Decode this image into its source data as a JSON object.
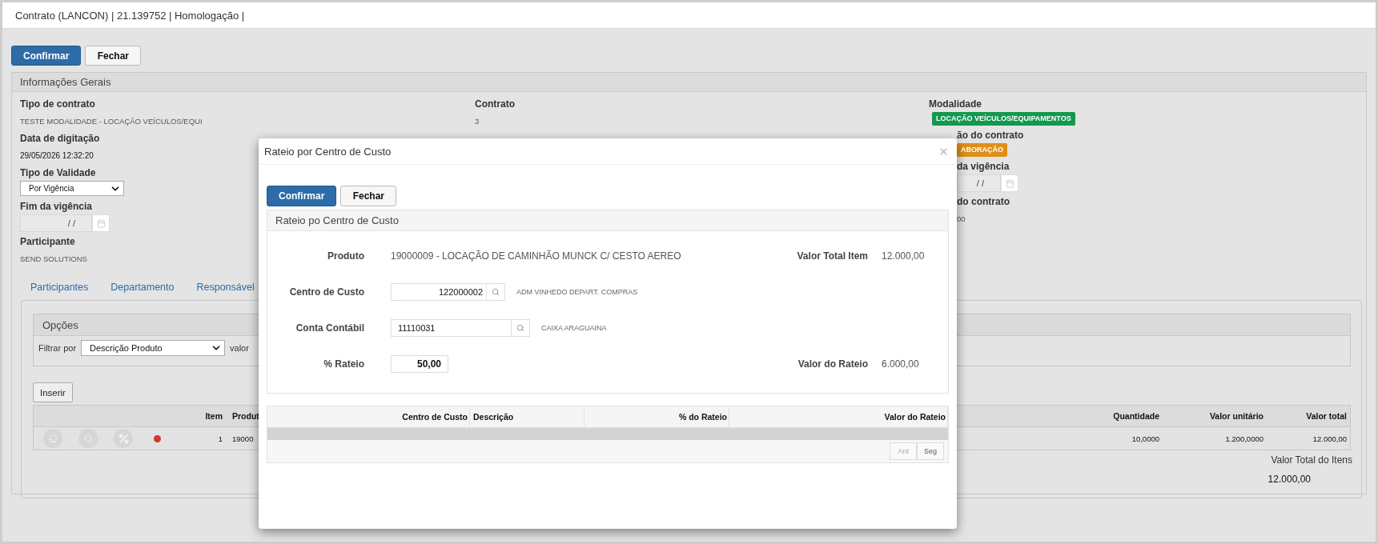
{
  "window": {
    "title": "Contrato (LANCON) | 21.139752 | Homologação |"
  },
  "toolbar": {
    "buttons": [
      {
        "label": "Confirmar",
        "kind": "primary"
      },
      {
        "label": "Fechar",
        "kind": "default"
      }
    ]
  },
  "general_info": {
    "title": "Informações Gerais",
    "column_1": [
      {
        "label": "Tipo de contrato",
        "value": "TESTE MODALIDADE - LOCAÇÃO VEÍCULOS/EQUI",
        "kind": "text"
      },
      {
        "label": "Data de digitação",
        "value": "29/05/2026 12:32:20",
        "kind": "strong"
      },
      {
        "label": "Tipo de Validade",
        "value": "Por Vigência",
        "kind": "select"
      },
      {
        "label": "Fim da vigência",
        "value": "/ /",
        "kind": "date"
      },
      {
        "label": "Participante",
        "value": "SEND SOLUTIONS",
        "kind": "text"
      }
    ],
    "column_2": [
      {
        "label": "Contrato",
        "value": "3",
        "kind": "text"
      }
    ],
    "column_3": [
      {
        "label": "Modalidade",
        "value": "LOCAÇÃO VEÍCULOS/EQUIPAMENTOS",
        "kind": "badge",
        "color": "#13994f",
        "cut": false
      },
      {
        "label": "ão do contrato",
        "value": "ABORAÇÃO",
        "kind": "badge",
        "color": "#e08e16",
        "cut": true
      },
      {
        "label": "da vigência",
        "value": "/ /",
        "kind": "date",
        "cut": true
      },
      {
        "label": "do contrato",
        "value": "00",
        "kind": "text",
        "cut": true
      }
    ]
  },
  "tabs": [
    {
      "label": "Participantes",
      "selected": false
    },
    {
      "label": "Departamento",
      "selected": false
    },
    {
      "label": "Responsável",
      "selected": false
    }
  ],
  "options": {
    "title": "Opções",
    "filter_label": "Filtrar por",
    "filter_value": "Descrição Produto",
    "value_label": "valor"
  },
  "insert_button": "Inserir",
  "items_table": {
    "columns": [
      "Item",
      "Produt",
      "Quantidade",
      "Valor unitário",
      "Valor total"
    ],
    "rows": [
      {
        "color": "#d23a2c",
        "item": "1",
        "product": "19000",
        "quantity": "10,0000",
        "unit_value": "1.200,0000",
        "total": "12.000,00"
      }
    ]
  },
  "items_total": {
    "label": "Valor Total do Itens",
    "value": "12.000,00"
  },
  "dialog": {
    "title": "Rateio por Centro de Custo",
    "buttons": [
      {
        "label": "Confirmar",
        "kind": "primary"
      },
      {
        "label": "Fechar",
        "kind": "default"
      }
    ],
    "panel_title": "Rateio po Centro de Custo",
    "product": {
      "label": "Produto",
      "value": "19000009 - LOCAÇÃO DE CAMINHÃO MUNCK C/ CESTO AEREO"
    },
    "item_total": {
      "label": "Valor Total Item",
      "value": "12.000,00"
    },
    "cost_center": {
      "label": "Centro de Custo",
      "value": "122000002",
      "description": "ADM VINHEDO DEPART. COMPRAS"
    },
    "account": {
      "label": "Conta Contábil",
      "value": "11110031",
      "description": "CAIXA ARAGUAINA"
    },
    "percent": {
      "label": "% Rateio",
      "value": "50,00"
    },
    "allocation_value": {
      "label": "Valor do Rateio",
      "value": "6.000,00"
    },
    "table": {
      "columns": [
        "Centro de Custo",
        "Descrição",
        "% do Rateio",
        "Valor do Rateio"
      ],
      "pager": [
        {
          "label": "Ant",
          "disabled": true
        },
        {
          "label": "Seg",
          "disabled": false
        }
      ]
    }
  }
}
